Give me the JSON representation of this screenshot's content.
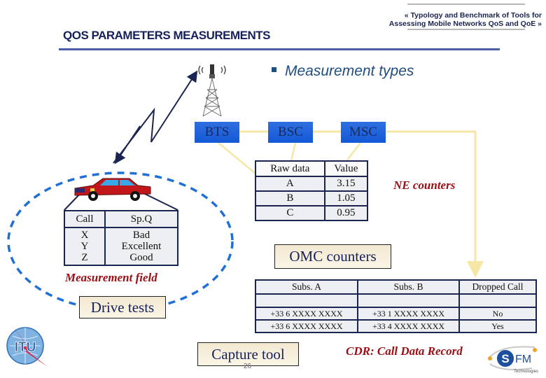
{
  "header": {
    "subtitle_line1": "« Typology and Benchmark of Tools for",
    "subtitle_line2": "Assessing Mobile Networks QoS and QoE »",
    "title": "QOS PARAMETERS MEASUREMENTS"
  },
  "section": {
    "bullet_heading": "Measurement types"
  },
  "network": {
    "nodes": [
      "BTS",
      "BSC",
      "MSC"
    ]
  },
  "ne_table": {
    "headers": [
      "Raw data",
      "Value"
    ],
    "rows": [
      [
        "A",
        "3.15"
      ],
      [
        "B",
        "1.05"
      ],
      [
        "C",
        "0.95"
      ]
    ]
  },
  "ne_label": "NE counters",
  "drive_table": {
    "headers": [
      "Call",
      "Sp.Q"
    ],
    "col1": [
      "X",
      "Y",
      "Z"
    ],
    "col2": [
      "Bad",
      "Excellent",
      "Good"
    ]
  },
  "measurement_field_label": "Measurement field",
  "drive_tests_label": "Drive tests",
  "omc_label": "OMC counters",
  "cdr_table": {
    "headers": [
      "Subs. A",
      "Subs. B",
      "Dropped Call"
    ],
    "rows": [
      [
        "",
        "",
        ""
      ],
      [
        "+33 6 XXXX XXXX",
        "+33 1 XXXX XXXX",
        "No"
      ],
      [
        "+33 6 XXXX XXXX",
        "+33 4 XXXX XXXX",
        "Yes"
      ]
    ]
  },
  "capture_tool_label": "Capture tool",
  "cdr_label": "CDR: Call Data Record",
  "page_number": "26",
  "logos": {
    "itu": "ITU",
    "sfm_main": "FM",
    "sfm_s": "S",
    "sfm_sub": "Technologies"
  },
  "colors": {
    "title": "#16205a",
    "rule": "#4a5ea8",
    "node_blue": "#1f63dc",
    "accent_red": "#9b0e14",
    "link_yellow": "#f6e7a6",
    "ellipse_blue": "#1f6fd6"
  }
}
